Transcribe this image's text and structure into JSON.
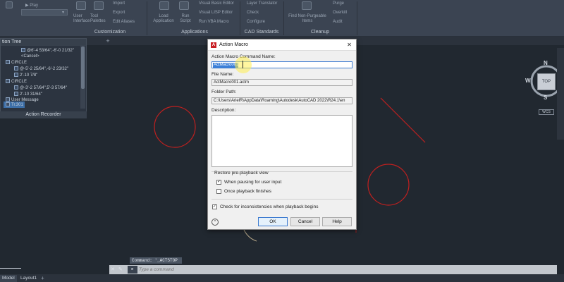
{
  "colors": {
    "canvas_bg": "#212830",
    "ribbon_bg": "#3b4452",
    "drawing_red": "#c0201f",
    "selection_blue": "#3b7fd8",
    "autodesk_red": "#c81e24"
  },
  "ribbon": {
    "items": [
      {
        "label": "Play",
        "icon": "play-icon"
      },
      {
        "label": "User Interface"
      },
      {
        "label": "Tool Palettes"
      },
      {
        "label": "Import"
      },
      {
        "label": "Export"
      },
      {
        "label": "Edit Aliases"
      },
      {
        "label": "Load Application"
      },
      {
        "label": "Run Script"
      },
      {
        "label": "Visual Basic Editor"
      },
      {
        "label": "Visual LISP Editor"
      },
      {
        "label": "Run VBA Macro"
      },
      {
        "label": "Layer Translator"
      },
      {
        "label": "Check"
      },
      {
        "label": "Configure"
      },
      {
        "label": "Find Non-Purgeable Items"
      },
      {
        "label": "Purge"
      },
      {
        "label": "Overkill"
      },
      {
        "label": "Audit"
      }
    ],
    "panels": [
      "Customization",
      "Applications",
      "CAD Standards",
      "Cleanup"
    ]
  },
  "action_tree": {
    "title": "tion Tree",
    "rows": [
      {
        "text": "@6'-4 53/64\",-6'-0 21/32\""
      },
      {
        "text": "<Cancel>"
      },
      {
        "text": "CIRCLE"
      },
      {
        "text": "@-5'-2 25/64\",-6'-2 23/32\""
      },
      {
        "text": "2'-10 7/8\""
      },
      {
        "text": "CIRCLE"
      },
      {
        "text": "@-3'-2 57/64\",5'-3 57/64\""
      },
      {
        "text": "2'-10 31/64\""
      },
      {
        "text": "User Message"
      },
      {
        "text": "Tr.301"
      }
    ],
    "recorder_label": "Action Recorder"
  },
  "viewcube": {
    "top": "TOP",
    "n": "N",
    "w": "W",
    "e": "E",
    "s": "S",
    "wcs": "WCS"
  },
  "dialog": {
    "title": "Action Macro",
    "close_glyph": "✕",
    "name_label": "Action Macro Command Name:",
    "name_value": "ActMacro001",
    "filename_label": "File Name:",
    "filename_value": "ActMacro001.actm",
    "folder_label": "Folder Path:",
    "folder_value": "C:\\Users\\ArielR\\AppData\\Roaming\\Autodesk\\AutoCAD 2022\\R24.1\\en",
    "description_label": "Description:",
    "description_value": "",
    "restore_label": "Restore pre-playback view",
    "when_pausing_label": "When pausing for user input",
    "when_pausing_checked": true,
    "once_finishes_label": "Once playback finishes",
    "once_finishes_checked": false,
    "check_inconsistencies_label": "Check for inconsistencies when playback begins",
    "check_inconsistencies_checked": true,
    "ok_label": "OK",
    "cancel_label": "Cancel",
    "help_label": "Help",
    "help_circle_glyph": "^"
  },
  "command": {
    "history": "Command: '_ACTSTOP",
    "placeholder": "Type a command",
    "prompt_glyph": "▸"
  },
  "layout_tabs": {
    "model": "Model",
    "layout1": "Layout1",
    "plus": "+"
  },
  "tabstrip": {
    "plus": "+"
  }
}
